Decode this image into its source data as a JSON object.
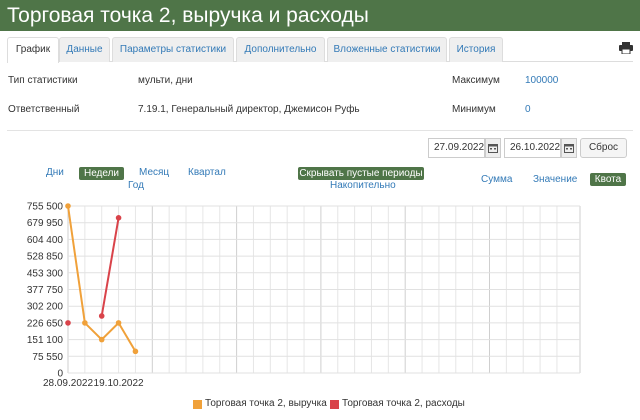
{
  "window": {
    "title": "Торговая точка 2, выручка и расходы"
  },
  "tabs": [
    {
      "label": "График",
      "active": true
    },
    {
      "label": "Данные",
      "active": false
    },
    {
      "label": "Параметры статистики",
      "active": false
    },
    {
      "label": "Дополнительно",
      "active": false
    },
    {
      "label": "Вложенные статистики",
      "active": false
    },
    {
      "label": "История",
      "active": false
    }
  ],
  "toolbar": {
    "print_icon": "printer-icon"
  },
  "info": {
    "type_label": "Тип статистики",
    "type_value": "мульти, дни",
    "responsible_label": "Ответственный",
    "responsible_value": "7.19.1, Генеральный директор, Джемисон Руфь",
    "max_label": "Максимум",
    "max_value": "100000",
    "min_label": "Минимум",
    "min_value": "0"
  },
  "date_range": {
    "from": "27.09.2022",
    "to": "26.10.2022",
    "reset_label": "Сброс",
    "calendar_icon": "calendar-icon"
  },
  "period": {
    "days": "Дни",
    "weeks": "Недели",
    "month": "Месяц",
    "quarter": "Квартал",
    "year": "Год",
    "active": "weeks"
  },
  "options": {
    "hide_empty": "Скрывать пустые периоды",
    "cumulative": "Накопительно"
  },
  "modes": {
    "sum": "Сумма",
    "value": "Значение",
    "quota": "Квота",
    "active": "quota"
  },
  "colors": {
    "revenue": "#f0a13a",
    "expenses": "#d9434a",
    "accent": "#4f7548",
    "link": "#337ab7"
  },
  "chart_data": {
    "type": "line",
    "ylim": [
      0,
      755500
    ],
    "y_ticks": [
      "755 500",
      "679 950",
      "604 400",
      "528 850",
      "453 300",
      "377 750",
      "302 200",
      "226 650",
      "151 100",
      "75 550",
      "0"
    ],
    "x_tick_labels": [
      "28.09.2022",
      "19.10.2022"
    ],
    "num_periods": 30,
    "series": [
      {
        "name": "Торговая точка 2, выручка",
        "color": "#f0a13a",
        "points": [
          [
            0,
            755500
          ],
          [
            1,
            226650
          ],
          [
            2,
            151100
          ],
          [
            3,
            226650
          ],
          [
            4,
            98000
          ]
        ]
      },
      {
        "name": "Торговая точка 2, расходы",
        "color": "#d9434a",
        "points": [
          [
            0,
            226650
          ],
          [
            2,
            258000
          ],
          [
            3,
            702000
          ]
        ]
      }
    ]
  }
}
